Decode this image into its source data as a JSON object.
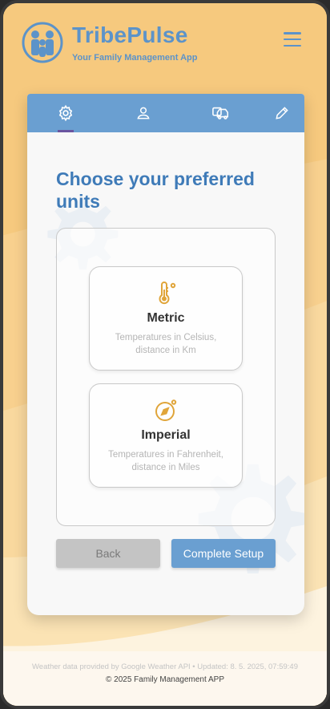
{
  "header": {
    "brand": "TribePulse",
    "tagline": "Your Family Management App"
  },
  "tabs": [
    {
      "icon": "gear-icon",
      "active": true
    },
    {
      "icon": "person-icon",
      "active": false
    },
    {
      "icon": "vehicles-icon",
      "active": false
    },
    {
      "icon": "pencil-icon",
      "active": false
    }
  ],
  "main": {
    "title": "Choose your preferred units",
    "options": [
      {
        "name": "Metric",
        "description": "Temperatures in Celsius, distance in Km",
        "icon": "thermometer-icon"
      },
      {
        "name": "Imperial",
        "description": "Temperatures in Fahrenheit, distance in Miles",
        "icon": "compass-icon"
      }
    ],
    "back_label": "Back",
    "complete_label": "Complete Setup"
  },
  "footer": {
    "weather_note": "Weather data provided by Google Weather API • Updated: 8. 5. 2025, 07:59:49",
    "copyright": "© 2025 Family Management APP"
  },
  "colors": {
    "accent": "#6a9fd1",
    "title": "#3f7bb8",
    "background": "#f6c97e",
    "icon_gold": "#e0a53a"
  }
}
